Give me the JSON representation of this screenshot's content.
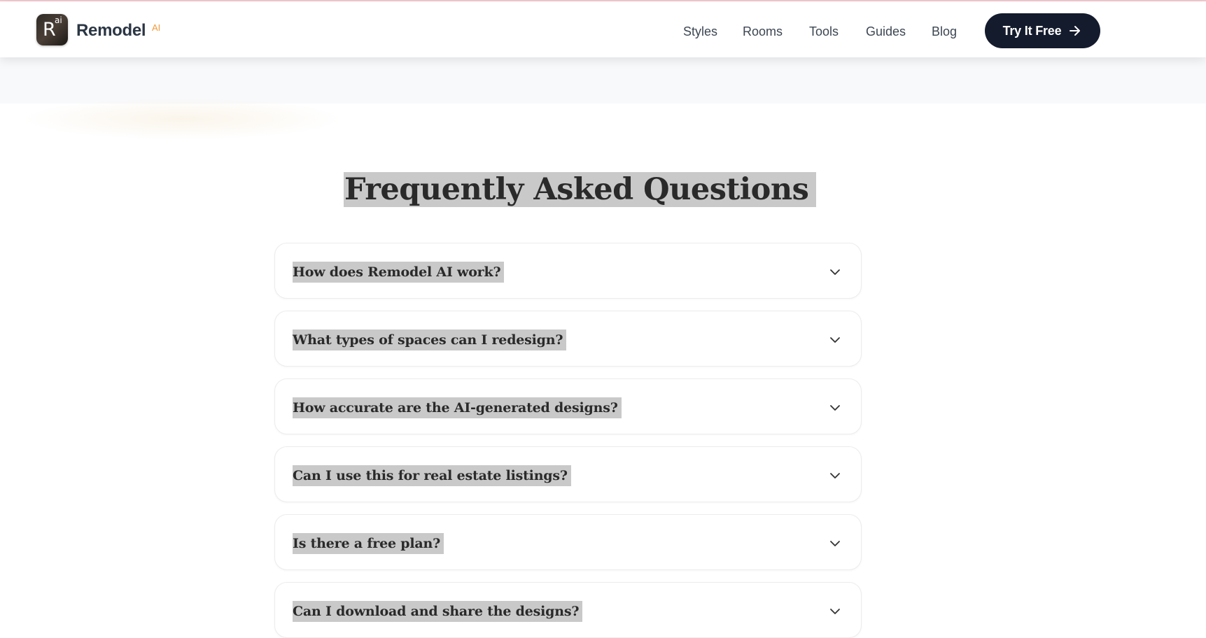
{
  "header": {
    "logo": {
      "letter": "R",
      "superscript": "ai"
    },
    "brand": {
      "name": "Remodel",
      "suffix": "AI"
    },
    "nav": [
      {
        "label": "Styles"
      },
      {
        "label": "Rooms"
      },
      {
        "label": "Tools"
      },
      {
        "label": "Guides"
      },
      {
        "label": "Blog"
      }
    ],
    "cta": {
      "label": "Try It Free",
      "icon": "arrow-right-icon"
    }
  },
  "faq": {
    "title": "Frequently Asked Questions",
    "items": [
      {
        "question": "How does Remodel AI work?",
        "icon": "chevron-down-icon"
      },
      {
        "question": "What types of spaces can I redesign?",
        "icon": "chevron-down-icon"
      },
      {
        "question": "How accurate are the AI-generated designs?",
        "icon": "chevron-down-icon"
      },
      {
        "question": "Can I use this for real estate listings?",
        "icon": "chevron-down-icon"
      },
      {
        "question": "Is there a free plan?",
        "icon": "chevron-down-icon"
      },
      {
        "question": "Can I download and share the designs?",
        "icon": "chevron-down-icon"
      }
    ]
  },
  "colors": {
    "cta_bg": "#141b2d",
    "brand_text": "#2b3644",
    "brand_accent": "#f29a3b",
    "selection_highlight": "#c9c9c9"
  }
}
